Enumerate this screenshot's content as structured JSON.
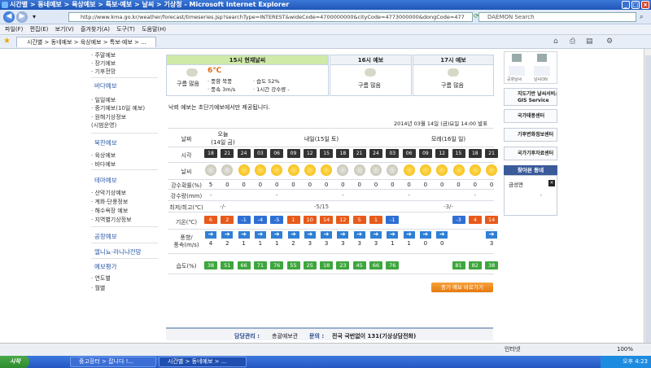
{
  "window": {
    "title": "시간별 > 동네예보 > 육상예보 > 특보·예보 > 날씨 > 기상청 - Microsoft Internet Explorer",
    "btn_min": "_",
    "btn_max": "□",
    "btn_close": "×"
  },
  "address": {
    "url": "http://www.kma.go.kr/weather/forecast/timeseries.jsp?searchType=INTEREST&wideCode=4700000000&cityCode=4773000000&dongCode=477",
    "search": "DAEMON Search"
  },
  "menu": [
    "파일(F)",
    "편집(E)",
    "보기(V)",
    "즐겨찾기(A)",
    "도구(T)",
    "도움말(H)"
  ],
  "tab": {
    "label": "시간별 > 동네예보 > 육상예보 > 특보·예보 > ..."
  },
  "sidebar": {
    "top_items": [
      "· 주말예보",
      "· 장기예보",
      "· 기후전망"
    ],
    "sections": [
      {
        "heading": "바다예보",
        "items": [
          "· 일일예보",
          "· 중기예보(10일 예보)",
          "· 원해기상정보",
          "  (시범운영)"
        ]
      },
      {
        "heading": "북한예보",
        "items": [
          "· 육상예보",
          "· 바다예보"
        ]
      },
      {
        "heading": "테마예보",
        "items": [
          "· 산악기상예보",
          "· 계화·단풍정보",
          "· 해수욕장 예보",
          "· 지역별기상정보"
        ]
      },
      {
        "heading": "공항예보",
        "items": []
      },
      {
        "heading": "엘니뇨·라니냐전망",
        "items": []
      },
      {
        "heading": "예보평가",
        "items": [
          "· 연도별",
          "· 월별"
        ]
      }
    ]
  },
  "days": [
    {
      "label": "15시 현재날씨",
      "sky": "구름 많음",
      "temp": "6℃",
      "details": [
        "· 풍향 북풍",
        "· 습도 52%",
        "· 풍속 3m/s",
        "· 1시간 강수량 -"
      ]
    },
    {
      "label": "16시 예보",
      "sky": "구름 많음"
    },
    {
      "label": "17시 예보",
      "sky": "구름 많음"
    }
  ],
  "notice": "낙뢰 예보는 초단기예보에서만 제공됩니다.",
  "announce": "2014년 03월 14일 (금)요일 14:00 발표",
  "forecast": {
    "row_labels": [
      "날짜",
      "시각",
      "날씨",
      "강수확률(%)",
      "강수량(mm)",
      "최저/최고(℃)",
      "기온(℃)",
      "풍향/\n풍속(m/s)",
      "습도(%)"
    ],
    "dates": [
      "오늘\n(14일 금)",
      "내일(15일 토)",
      "모레(16일 일)"
    ],
    "hours": [
      "18",
      "21",
      "24",
      "03",
      "06",
      "09",
      "12",
      "15",
      "18",
      "21",
      "24",
      "03",
      "06",
      "09",
      "12",
      "15",
      "18",
      "21"
    ],
    "sky": [
      "cloudy",
      "cloudy",
      "sunny",
      "sunny",
      "sunny",
      "sunny",
      "sunny",
      "sunny",
      "cloudy",
      "cloudy",
      "cloudy",
      "cloudy",
      "sunny",
      "sunny",
      "sunny",
      "sunny",
      "sunny",
      "sunny"
    ],
    "precip_prob": [
      "5",
      "0",
      "0",
      "0",
      "0",
      "0",
      "0",
      "0",
      "0",
      "0",
      "0",
      "0",
      "0",
      "0",
      "0",
      "0",
      "0",
      "0"
    ],
    "precip_amt": [
      "-",
      "-",
      "-",
      "-",
      "-",
      "-"
    ],
    "minmax": [
      "-/-",
      "-5/15",
      "-3/-"
    ],
    "temps": [
      "6",
      "2",
      "-1",
      "-4",
      "-5",
      "1",
      "10",
      "14",
      "12",
      "5",
      "1",
      "-1",
      "-3",
      "4",
      "14"
    ],
    "wind_speeds": [
      "4",
      "2",
      "1",
      "1",
      "1",
      "2",
      "3",
      "3",
      "3",
      "3",
      "3",
      "1",
      "1",
      "0",
      "0",
      "3"
    ],
    "humidity": [
      "38",
      "51",
      "66",
      "71",
      "76",
      "55",
      "25",
      "18",
      "23",
      "45",
      "66",
      "76",
      "81",
      "82",
      "38"
    ]
  },
  "button_more": "중기 예보 바로가기",
  "footer": {
    "manager_label": "담당관리 :",
    "manager": "총괄예보관",
    "contact_label": "문의 :",
    "contact": "전국 국번없이 131(기상상담전화)"
  },
  "right_panel": {
    "icon1": "경계정보",
    "icon2": "날씨TV",
    "icon3": "공항날씨",
    "icon4": "날씨ON",
    "link1": "지도기반 날씨서비스\nGIS Service",
    "link2": "국가태풍센터",
    "link3": "기후변화정보센터",
    "link4": "국가기후자료센터",
    "fav_heading": "찾아본 동네",
    "fav_item": "금성면"
  },
  "status": {
    "left": "",
    "zone": "인터넷",
    "zoom": "100%"
  },
  "taskbar": {
    "start": "시작",
    "items": [
      "중고장터 > 잡니다 !...",
      "시간별 > 동네예보 > ..."
    ],
    "time": "오후 4:23"
  }
}
